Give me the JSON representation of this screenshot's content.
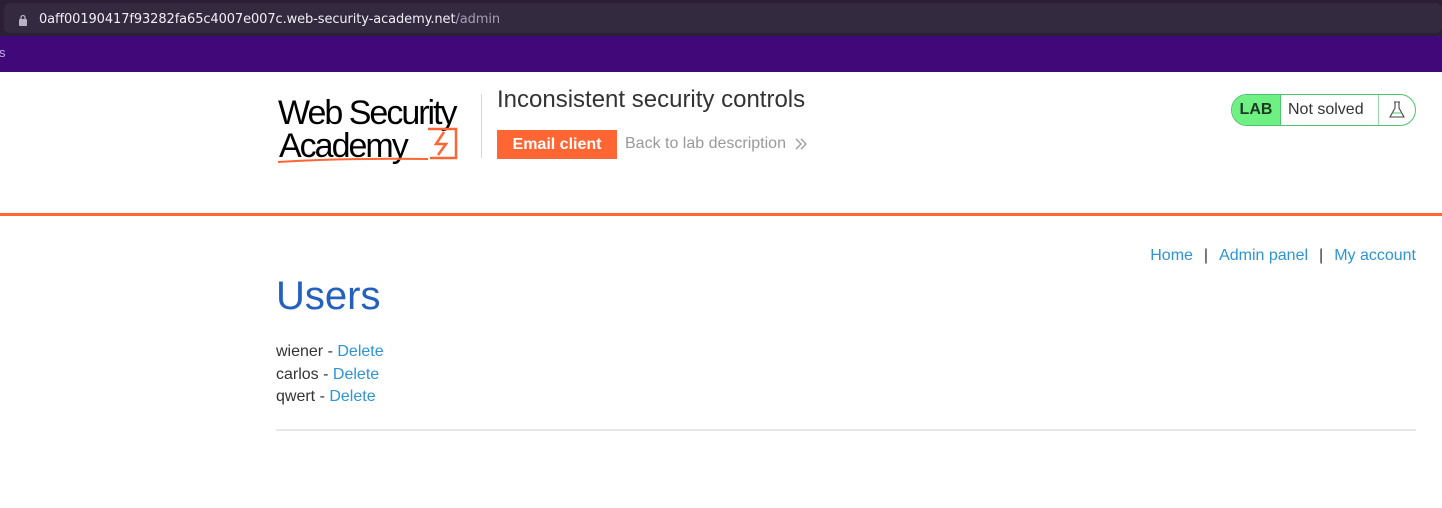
{
  "browser": {
    "url_host": "0aff00190417f93282fa65c4007e007c.web-security-academy.net",
    "url_path": "/admin",
    "bookmark_edge": "s"
  },
  "header": {
    "logo_line1": "Web Security",
    "logo_line2": "Academy",
    "lab_title": "Inconsistent security controls",
    "email_button": "Email client",
    "back_link": "Back to lab description",
    "lab_tag": "LAB",
    "lab_status": "Not solved"
  },
  "nav": {
    "items": [
      {
        "label": "Home"
      },
      {
        "label": "Admin panel"
      },
      {
        "label": "My account"
      }
    ],
    "separator": "|"
  },
  "main": {
    "title": "Users",
    "users": [
      {
        "name": "wiener",
        "dash": " - ",
        "action": "Delete"
      },
      {
        "name": "carlos",
        "dash": " - ",
        "action": "Delete"
      },
      {
        "name": "qwert",
        "dash": " - ",
        "action": "Delete"
      }
    ]
  },
  "colors": {
    "accent": "#ff6633",
    "title_blue": "#2461bf",
    "link_blue": "#2d94d6",
    "lab_green": "#6ef082",
    "bookmark_bar": "#41087a"
  }
}
